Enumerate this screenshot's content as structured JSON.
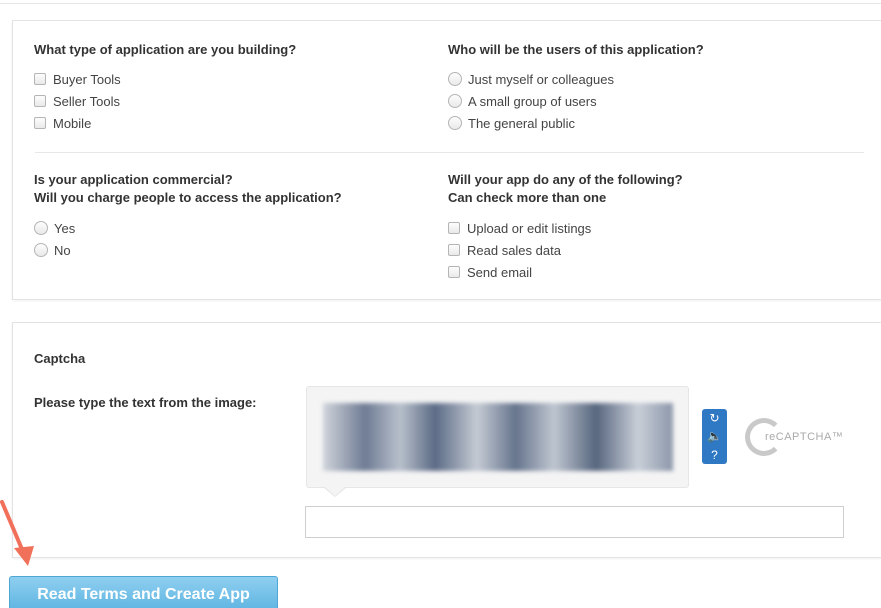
{
  "questions": {
    "app_type": {
      "title": "What type of application are you building?",
      "options": [
        "Buyer Tools",
        "Seller Tools",
        "Mobile"
      ]
    },
    "users": {
      "title": "Who will be the users of this application?",
      "options": [
        "Just myself or colleagues",
        "A small group of users",
        "The general public"
      ]
    },
    "commercial": {
      "title_line1": "Is your application commercial?",
      "title_line2": "Will you charge people to access the application?",
      "options": [
        "Yes",
        "No"
      ]
    },
    "features": {
      "title_line1": "Will your app do any of the following?",
      "title_line2": "Can check more than one",
      "options": [
        "Upload or edit listings",
        "Read sales data",
        "Send email"
      ]
    }
  },
  "captcha": {
    "title": "Captcha",
    "prompt": "Please type the text from the image:",
    "logo_text": "reCAPTCHA™",
    "input_value": ""
  },
  "submit": {
    "label": "Read Terms and Create App"
  },
  "colors": {
    "button_top": "#8fcff0",
    "button_bottom": "#5bb3e0",
    "captcha_buttons": "#2f79c4",
    "arrow": "#f0705a"
  }
}
